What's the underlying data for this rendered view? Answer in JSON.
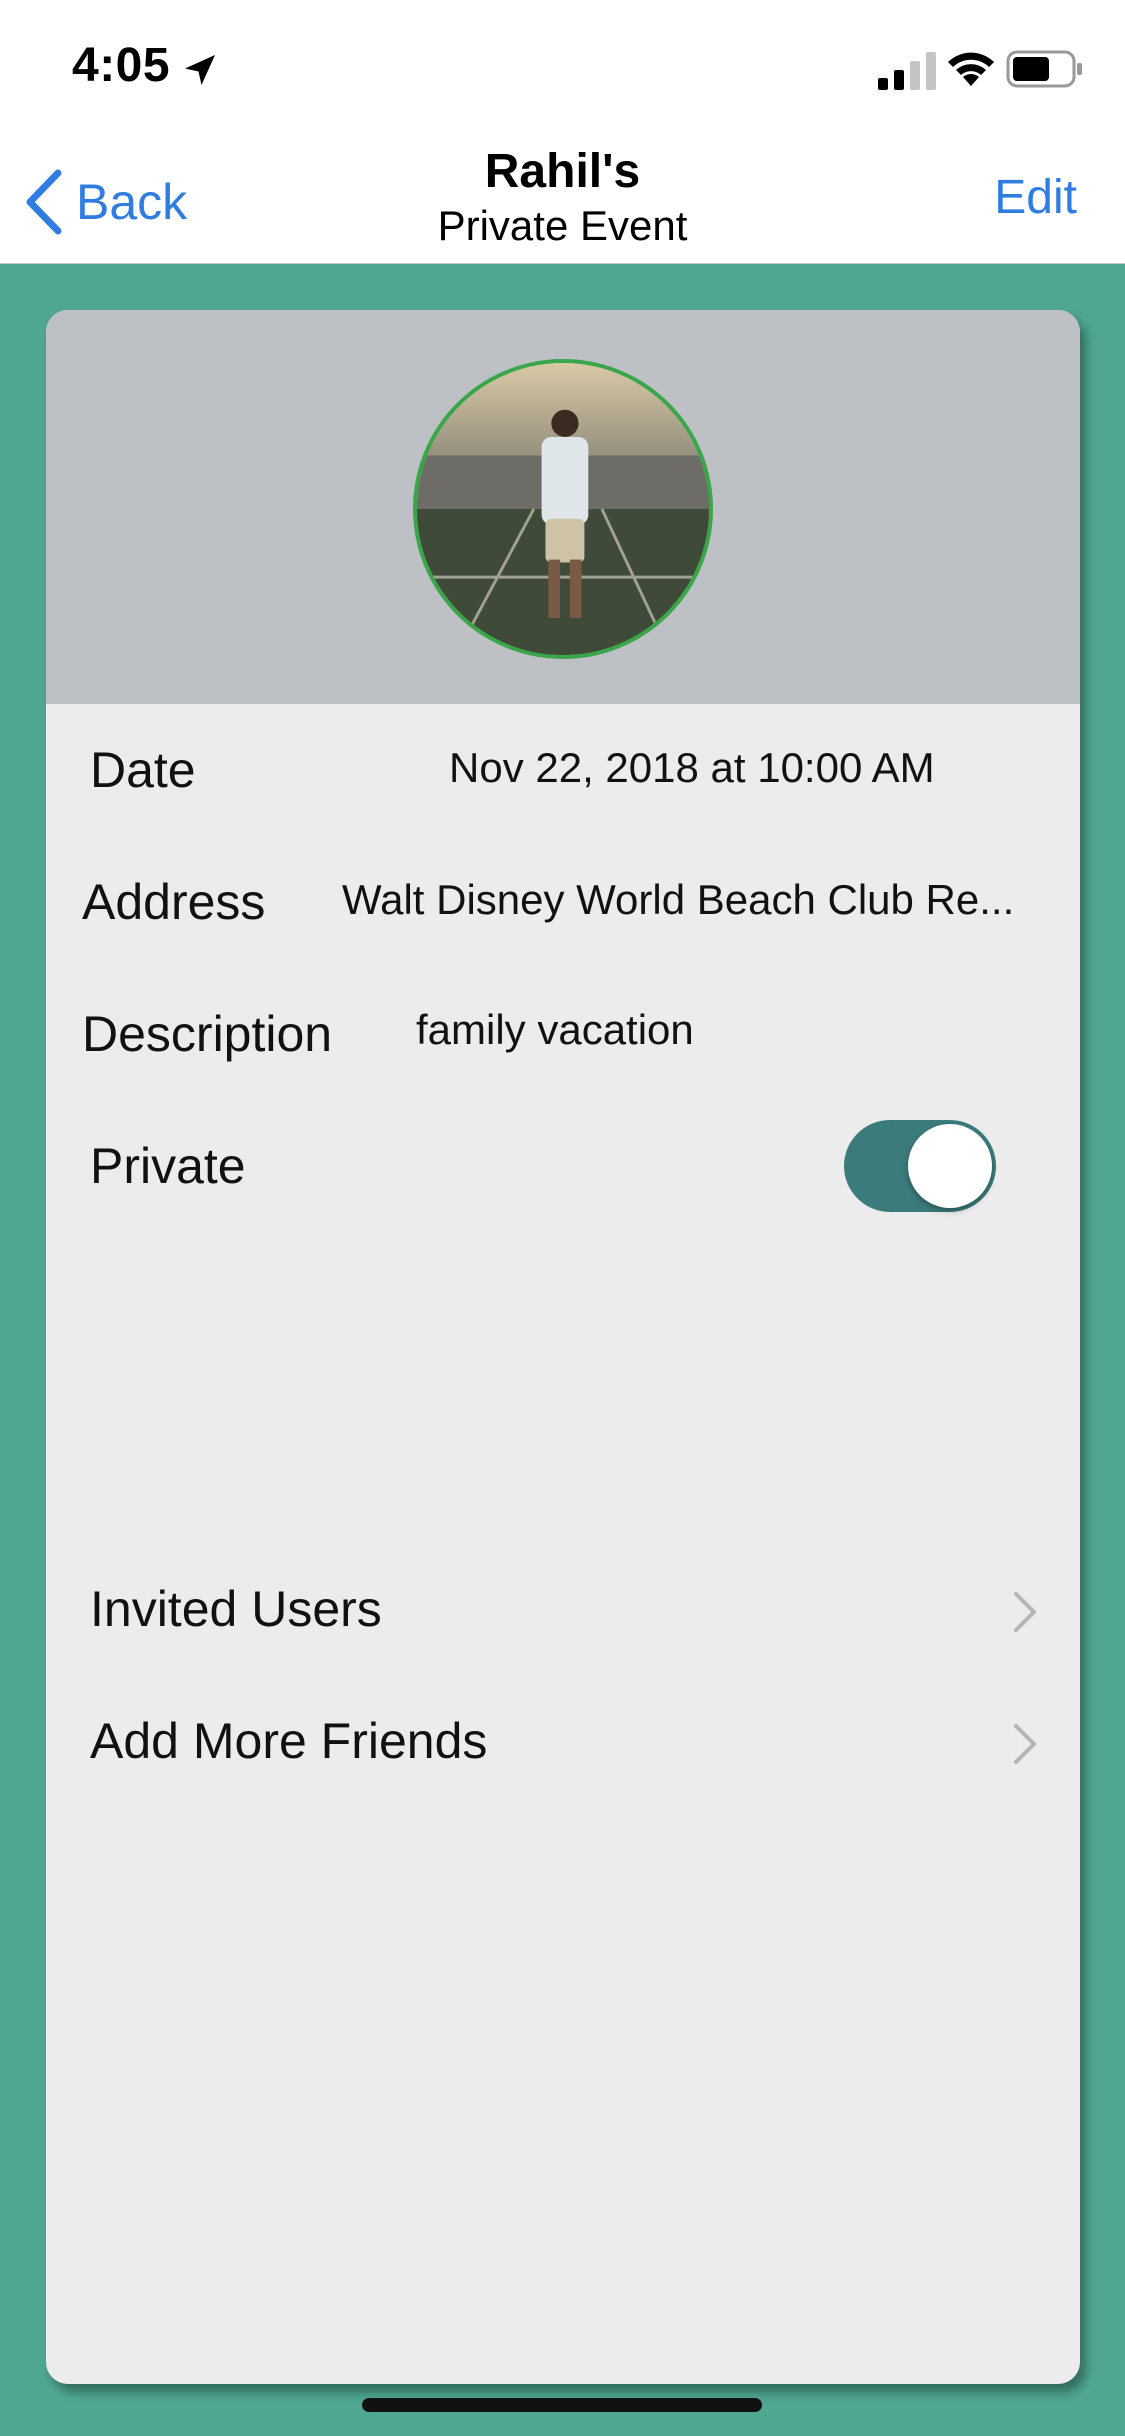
{
  "status_bar": {
    "time": "4:05",
    "icons": [
      "location-arrow-icon",
      "cellular-signal-icon",
      "wifi-icon",
      "battery-icon"
    ]
  },
  "nav": {
    "back_label": "Back",
    "title": "Rahil's",
    "subtitle": "Private Event",
    "edit_label": "Edit"
  },
  "event": {
    "date_label": "Date",
    "date_value": "Nov 22, 2018 at 10:00 AM",
    "address_label": "Address",
    "address_value": "Walt Disney World Beach Club Re...",
    "description_label": "Description",
    "description_value": "family vacation",
    "private_label": "Private",
    "private_on": true,
    "invited_users_label": "Invited Users",
    "add_friends_label": "Add More Friends"
  },
  "colors": {
    "background": "#4fa792",
    "accent": "#2f7de1",
    "toggle_on": "#3b7b7c",
    "avatar_border": "#3aa64a"
  }
}
